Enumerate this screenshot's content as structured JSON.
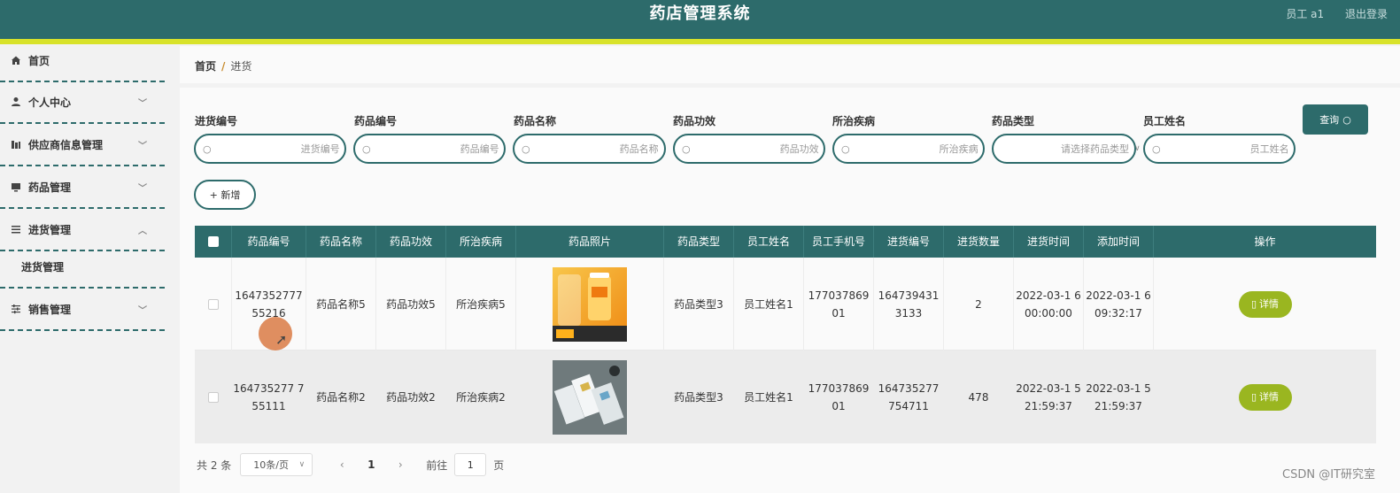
{
  "header": {
    "title": "药店管理系统",
    "user_label": "员工 a1",
    "logout_label": "退出登录",
    "bg_color": "#2d6b6b",
    "stripe_color": "#d8e22a"
  },
  "sidebar": {
    "items": [
      {
        "label": "首页",
        "icon": "home-icon"
      },
      {
        "label": "个人中心",
        "icon": "user-icon"
      },
      {
        "label": "供应商信息管理",
        "icon": "building-icon"
      },
      {
        "label": "药品管理",
        "icon": "monitor-icon"
      },
      {
        "label": "进货管理",
        "icon": "list-icon"
      },
      {
        "label": "销售管理",
        "icon": "sliders-icon"
      }
    ],
    "sub_items": [
      {
        "label": "进货管理"
      }
    ]
  },
  "breadcrumb": {
    "home": "首页",
    "separator": "/",
    "current": "进货"
  },
  "filters": [
    {
      "label": "进货编号",
      "placeholder": "进货编号"
    },
    {
      "label": "药品编号",
      "placeholder": "药品编号"
    },
    {
      "label": "药品名称",
      "placeholder": "药品名称"
    },
    {
      "label": "药品功效",
      "placeholder": "药品功效"
    },
    {
      "label": "所治疾病",
      "placeholder": "所治疾病"
    },
    {
      "label": "药品类型",
      "placeholder": "请选择药品类型"
    },
    {
      "label": "员工姓名",
      "placeholder": "员工姓名"
    }
  ],
  "buttons": {
    "query": "查询",
    "add": "+ 新增",
    "detail": "详情"
  },
  "table": {
    "headers": [
      "药品编号",
      "药品名称",
      "药品功效",
      "所治疾病",
      "药品照片",
      "药品类型",
      "员工姓名",
      "员工手机号",
      "进货编号",
      "进货数量",
      "进货时间",
      "添加时间",
      "操作"
    ],
    "rows": [
      {
        "drug_no": "1647352777 55216",
        "drug_name": "药品名称5",
        "effect": "药品功效5",
        "disease": "所治疾病5",
        "photo": "orange-supplement-bottle-photo",
        "type": "药品类型3",
        "employee": "员工姓名1",
        "phone": "177037869 01",
        "purchase_no": "164739431 3133",
        "qty": "2",
        "purchase_time": "2022-03-1 6 00:00:00",
        "added_time": "2022-03-1 6 09:32:17"
      },
      {
        "drug_no": "164735277 755111",
        "drug_name": "药品名称2",
        "effect": "药品功效2",
        "disease": "所治疾病2",
        "photo": "medicine-boxes-photo",
        "type": "药品类型3",
        "employee": "员工姓名1",
        "phone": "177037869 01",
        "purchase_no": "164735277 754711",
        "qty": "478",
        "purchase_time": "2022-03-1 5 21:59:37",
        "added_time": "2022-03-1 5 21:59:37"
      }
    ]
  },
  "pagination": {
    "total": "共 2 条",
    "page_size": "10条/页",
    "current_page": "1",
    "goto_label": "前往",
    "goto_value": "1",
    "page_suffix": "页"
  },
  "watermark": "CSDN @IT研究室"
}
